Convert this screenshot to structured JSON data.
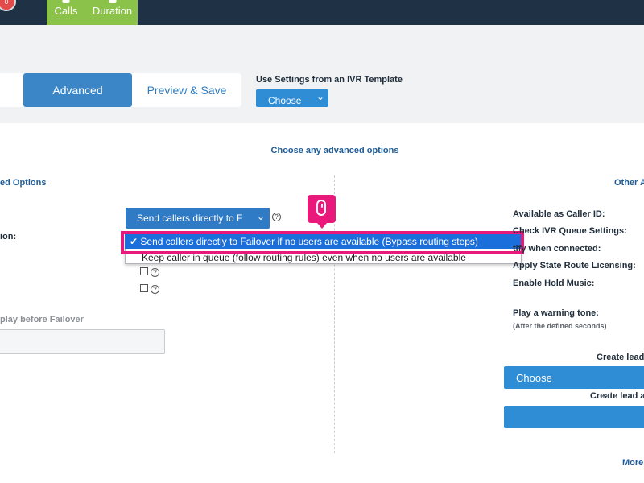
{
  "nav": {
    "notification_count": "0",
    "tabs": [
      {
        "label": "Calls"
      },
      {
        "label": "Duration"
      }
    ]
  },
  "wizard": {
    "tab_advanced": "Advanced",
    "tab_preview": "Preview & Save",
    "template_label": "Use Settings from an IVR Template",
    "template_choose": "Choose"
  },
  "advanced": {
    "heading": "Choose any advanced options",
    "left_title_partial": "ed Options",
    "right_title_partial": "Other A",
    "failover_select_value": "Send callers directly to F",
    "left_label_partial": "ion:",
    "failover_play_label_partial": "play before Failover"
  },
  "dropdown": {
    "selected_option": "✔ Send callers directly to Failover if no users are available (Bypass routing steps)",
    "other_option": "Keep caller in queue (follow routing rules) even when no users are available"
  },
  "right_panel": {
    "caller_id": "Available as Caller ID:",
    "ivr_queue": "Check IVR Queue Settings:",
    "notify": "tify when connected:",
    "state_route": "Apply State Route Licensing:",
    "hold_music": "Enable Hold Music:",
    "warning_tone": "Play a warning tone:",
    "after_seconds": "(After the defined seconds)",
    "create_lead_1": "Create lead",
    "lead_choose": "Choose",
    "create_lead_2": "Create lead a",
    "more": "More"
  },
  "icons": {
    "help": "help-icon",
    "dropdown_arrow": "chevron-down-icon",
    "mouse": "mouse-click-icon"
  },
  "colors": {
    "nav_bg": "#1f3144",
    "green_tab": "#8bc34a",
    "accent_blue": "#3b86c6",
    "highlight": "#e8197b",
    "selected_option": "#1a6fdc"
  }
}
